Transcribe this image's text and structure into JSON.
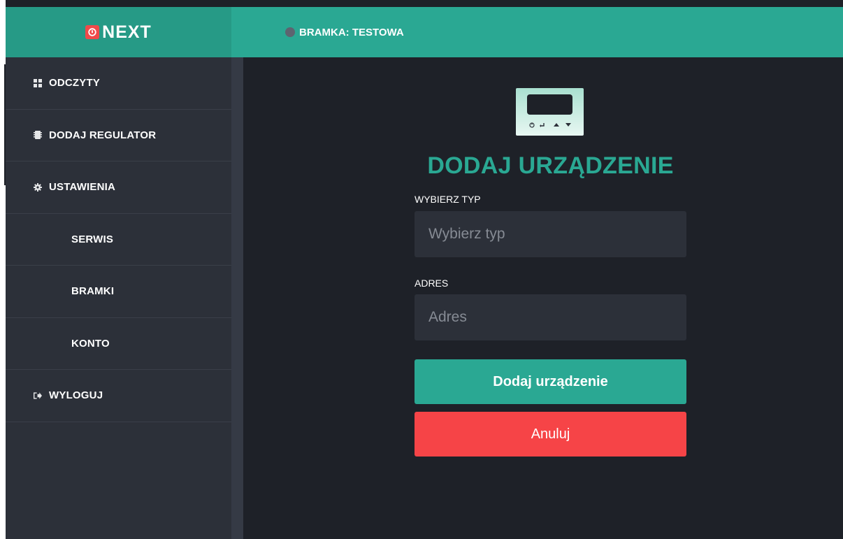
{
  "header": {
    "logo_text": "NEXT",
    "gateway_label": "BRAMKA: TESTOWA"
  },
  "sidebar": {
    "items": [
      {
        "label": "ODCZYTY",
        "icon": "grid-icon"
      },
      {
        "label": "DODAJ REGULATOR",
        "icon": "chip-icon"
      },
      {
        "label": "USTAWIENIA",
        "icon": "gear-icon"
      },
      {
        "label": "SERWIS"
      },
      {
        "label": "BRAMKI"
      },
      {
        "label": "KONTO"
      },
      {
        "label": "WYLOGUJ",
        "icon": "logout-icon"
      }
    ]
  },
  "main": {
    "title": "DODAJ URZĄDZENIE",
    "type_field": {
      "label": "WYBIERZ TYP",
      "placeholder": "Wybierz typ",
      "value": ""
    },
    "address_field": {
      "label": "ADRES",
      "placeholder": "Adres",
      "value": ""
    },
    "add_button": "Dodaj urządzenie",
    "cancel_button": "Anuluj"
  },
  "colors": {
    "accent": "#2aa893",
    "danger": "#f64447",
    "background": "#1e2128",
    "sidebar": "#2c3039",
    "logo": "#f04a4a"
  }
}
